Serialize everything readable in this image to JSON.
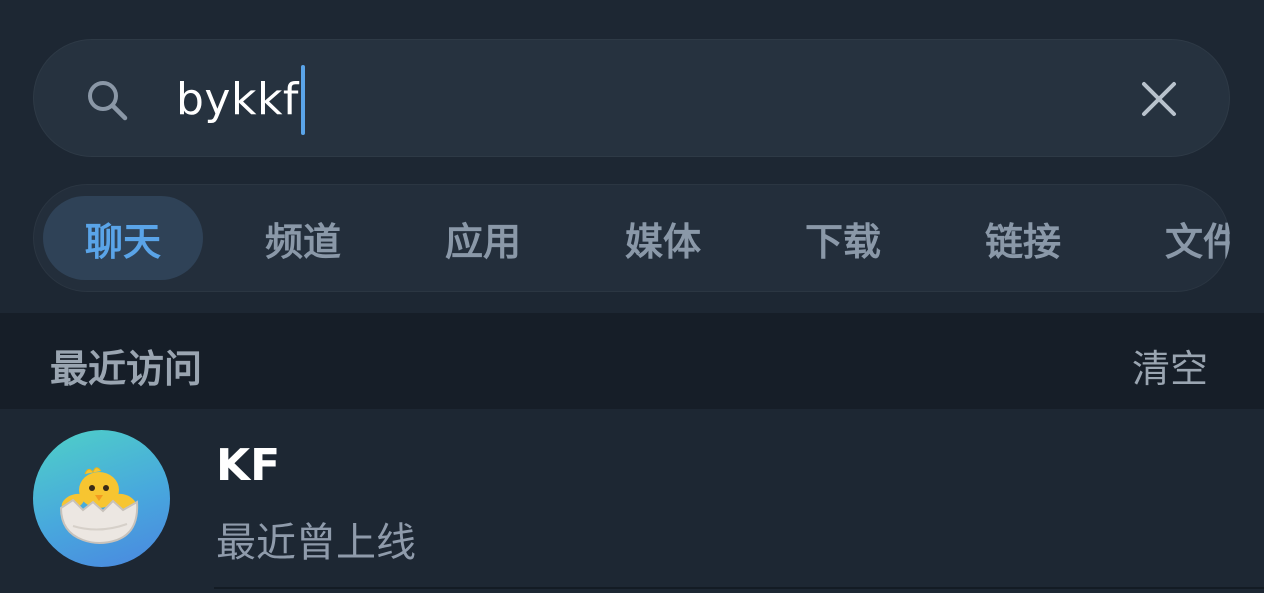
{
  "search": {
    "query": "bykkf"
  },
  "tabs": [
    {
      "label": "聊天",
      "active": true
    },
    {
      "label": "频道",
      "active": false
    },
    {
      "label": "应用",
      "active": false
    },
    {
      "label": "媒体",
      "active": false
    },
    {
      "label": "下载",
      "active": false
    },
    {
      "label": "链接",
      "active": false
    },
    {
      "label": "文件",
      "active": false
    }
  ],
  "recent": {
    "title": "最近访问",
    "clear_label": "清空",
    "items": [
      {
        "name": "KF",
        "status": "最近曾上线",
        "avatar_icon": "hatching-chick-icon"
      }
    ]
  },
  "colors": {
    "background": "#1d2733",
    "accent": "#5aa4e8",
    "section_header_bg": "#161e28"
  }
}
